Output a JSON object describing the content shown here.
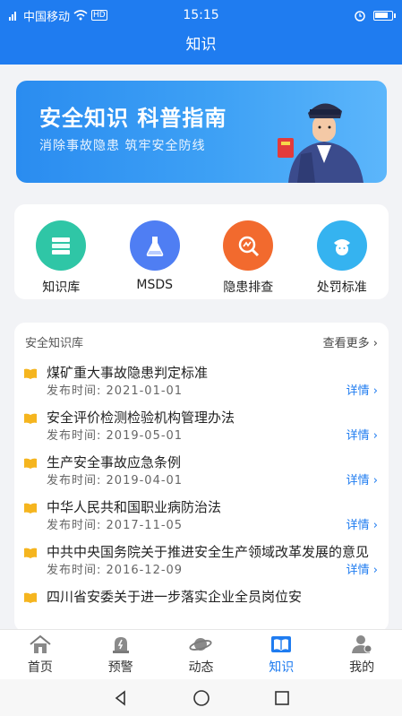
{
  "status_bar": {
    "carrier": "中国移动",
    "time": "15:15",
    "battery_level": 0.85
  },
  "header": {
    "title": "知识"
  },
  "banner": {
    "title": "安全知识 科普指南",
    "subtitle": "消除事故隐患 筑牢安全防线"
  },
  "categories": [
    {
      "label": "知识库",
      "icon": "books-icon",
      "color": "#2fc6a6"
    },
    {
      "label": "MSDS",
      "icon": "flask-icon",
      "color": "#4f7ef3"
    },
    {
      "label": "隐患排查",
      "icon": "search-chart-icon",
      "color": "#f26a2e"
    },
    {
      "label": "处罚标准",
      "icon": "police-icon",
      "color": "#35b3f0"
    }
  ],
  "knowledge_list": {
    "title": "安全知识库",
    "more_label": "查看更多",
    "detail_label": "详情",
    "items": [
      {
        "title": "煤矿重大事故隐患判定标准",
        "date_label": "发布时间:",
        "date": "2021-01-01"
      },
      {
        "title": "安全评价检测检验机构管理办法",
        "date_label": "发布时间:",
        "date": "2019-05-01"
      },
      {
        "title": "生产安全事故应急条例",
        "date_label": "发布时间:",
        "date": "2019-04-01"
      },
      {
        "title": "中华人民共和国职业病防治法",
        "date_label": "发布时间:",
        "date": "2017-11-05"
      },
      {
        "title": "中共中央国务院关于推进安全生产领域改革发展的意见",
        "date_label": "发布时间:",
        "date": "2016-12-09"
      },
      {
        "title": "四川省安委关于进一步落实企业全员岗位安",
        "date_label": "",
        "date": ""
      }
    ]
  },
  "tabbar": [
    {
      "label": "首页",
      "icon": "home-icon"
    },
    {
      "label": "预警",
      "icon": "alarm-icon"
    },
    {
      "label": "动态",
      "icon": "planet-icon"
    },
    {
      "label": "知识",
      "icon": "knowledge-book-icon",
      "active": true
    },
    {
      "label": "我的",
      "icon": "user-icon"
    }
  ],
  "colors": {
    "primary": "#1f7cf0"
  }
}
